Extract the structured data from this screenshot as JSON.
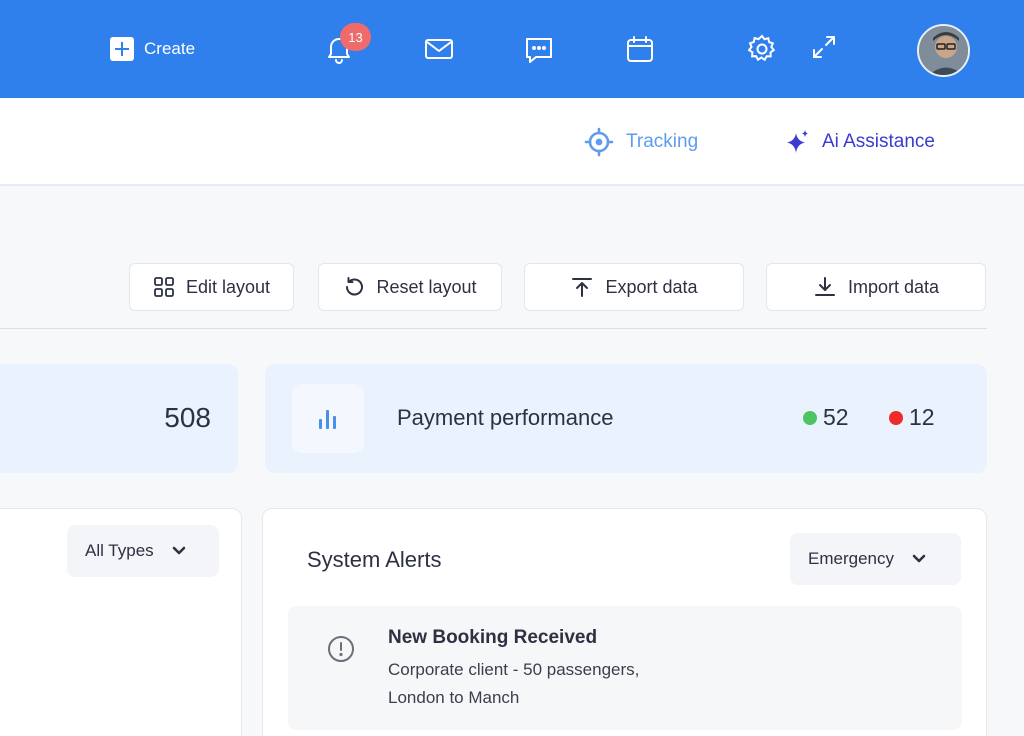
{
  "topbar": {
    "create_label": "Create",
    "notification_count": "13",
    "icons": [
      "plus-icon",
      "bell-icon",
      "mail-icon",
      "chat-icon",
      "calendar-icon",
      "gear-icon",
      "expand-icon"
    ]
  },
  "subbar": {
    "tracking_label": "Tracking",
    "ai_label": "Ai Assistance"
  },
  "toolbar": {
    "edit_layout": "Edit layout",
    "reset_layout": "Reset layout",
    "export_data": "Export data",
    "import_data": "Import data"
  },
  "stats": {
    "left_value": "508",
    "payment": {
      "title": "Payment performance",
      "success_count": "52",
      "failed_count": "12"
    }
  },
  "left_panel": {
    "filter_value": "All Types"
  },
  "alerts_panel": {
    "title": "System Alerts",
    "filter_value": "Emergency",
    "items": [
      {
        "title": "New Booking Received",
        "line1": "Corporate client - 50 passengers,",
        "line2": "London to Manch"
      }
    ]
  },
  "colors": {
    "primary": "#2f80ed",
    "tracking": "#5f9cec",
    "ai": "#3b3ccf",
    "success": "#4cc463",
    "danger": "#ee2b2b",
    "badge": "#ef6b6b"
  }
}
